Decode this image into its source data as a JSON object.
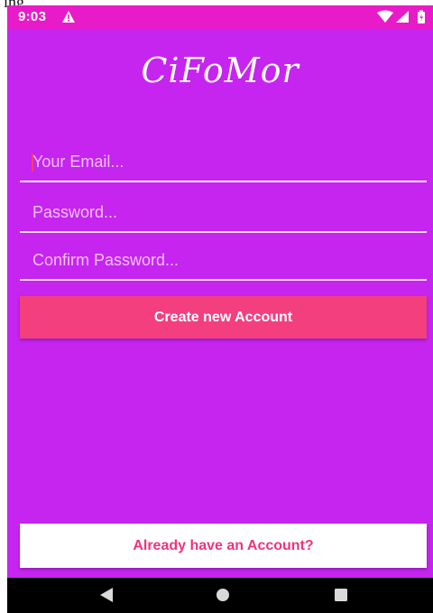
{
  "caption": "ing",
  "status_bar": {
    "time": "9:03",
    "icons": [
      "warning-icon",
      "wifi-icon",
      "signal-icon",
      "battery-icon"
    ]
  },
  "app": {
    "title": "CiFoMor"
  },
  "form": {
    "email_placeholder": "Your Email...",
    "password_placeholder": "Password...",
    "confirm_placeholder": "Confirm Password...",
    "create_label": "Create new Account"
  },
  "footer": {
    "login_label": "Already have an Account?"
  },
  "nav_bar": {
    "icons": [
      "back-icon",
      "home-icon",
      "recents-icon"
    ]
  },
  "colors": {
    "background": "#c624ef",
    "status_bar": "#e81bc9",
    "accent_button": "#f43f7f",
    "login_text": "#f2327c"
  }
}
